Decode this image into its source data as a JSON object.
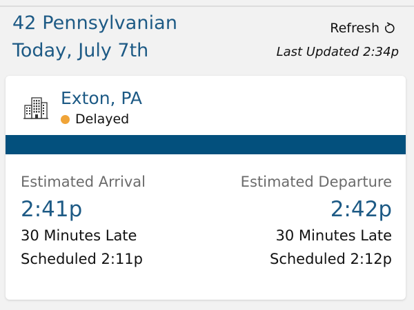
{
  "header": {
    "train_title": "42 Pennsylvanian",
    "date": "Today, July 7th",
    "refresh_label": "Refresh",
    "last_updated": "Last Updated 2:34p"
  },
  "station": {
    "name": "Exton, PA",
    "status": "Delayed",
    "status_color": "#f0a438",
    "icon": "building-icon",
    "progress_fraction": 1.0
  },
  "arrival": {
    "label": "Estimated Arrival",
    "time": "2:41p",
    "late": "30 Minutes Late",
    "scheduled": "Scheduled 2:11p"
  },
  "departure": {
    "label": "Estimated Departure",
    "time": "2:42p",
    "late": "30 Minutes Late",
    "scheduled": "Scheduled 2:12p"
  },
  "colors": {
    "accent": "#1d5a85",
    "bar": "#03507d",
    "background": "#f2f2f2"
  }
}
